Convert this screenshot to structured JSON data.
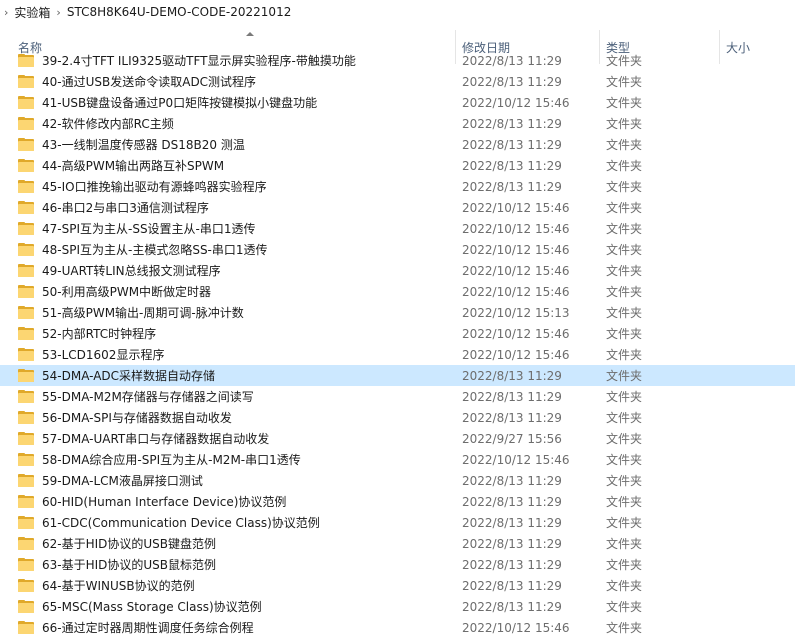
{
  "breadcrumb": {
    "items": [
      "实验箱",
      "STC8H8K64U-DEMO-CODE-20221012"
    ]
  },
  "columns": {
    "name": "名称",
    "date": "修改日期",
    "type": "类型",
    "size": "大小"
  },
  "rows": [
    {
      "name": "39-2.4寸TFT ILI9325驱动TFT显示屏实验程序-带触摸功能",
      "date": "2022/8/13 11:29",
      "type": "文件夹"
    },
    {
      "name": "40-通过USB发送命令读取ADC测试程序",
      "date": "2022/8/13 11:29",
      "type": "文件夹"
    },
    {
      "name": "41-USB键盘设备通过P0口矩阵按键模拟小键盘功能",
      "date": "2022/10/12 15:46",
      "type": "文件夹"
    },
    {
      "name": "42-软件修改内部RC主频",
      "date": "2022/8/13 11:29",
      "type": "文件夹"
    },
    {
      "name": "43-一线制温度传感器 DS18B20 测温",
      "date": "2022/8/13 11:29",
      "type": "文件夹"
    },
    {
      "name": "44-高级PWM输出两路互补SPWM",
      "date": "2022/8/13 11:29",
      "type": "文件夹"
    },
    {
      "name": "45-IO口推挽输出驱动有源蜂鸣器实验程序",
      "date": "2022/8/13 11:29",
      "type": "文件夹"
    },
    {
      "name": "46-串口2与串口3通信测试程序",
      "date": "2022/10/12 15:46",
      "type": "文件夹"
    },
    {
      "name": "47-SPI互为主从-SS设置主从-串口1透传",
      "date": "2022/10/12 15:46",
      "type": "文件夹"
    },
    {
      "name": "48-SPI互为主从-主模式忽略SS-串口1透传",
      "date": "2022/10/12 15:46",
      "type": "文件夹"
    },
    {
      "name": "49-UART转LIN总线报文测试程序",
      "date": "2022/10/12 15:46",
      "type": "文件夹"
    },
    {
      "name": "50-利用高级PWM中断做定时器",
      "date": "2022/10/12 15:46",
      "type": "文件夹"
    },
    {
      "name": "51-高级PWM输出-周期可调-脉冲计数",
      "date": "2022/10/12 15:13",
      "type": "文件夹"
    },
    {
      "name": "52-内部RTC时钟程序",
      "date": "2022/10/12 15:46",
      "type": "文件夹"
    },
    {
      "name": "53-LCD1602显示程序",
      "date": "2022/10/12 15:46",
      "type": "文件夹"
    },
    {
      "name": "54-DMA-ADC采样数据自动存储",
      "date": "2022/8/13 11:29",
      "type": "文件夹",
      "selected": true
    },
    {
      "name": "55-DMA-M2M存储器与存储器之间读写",
      "date": "2022/8/13 11:29",
      "type": "文件夹"
    },
    {
      "name": "56-DMA-SPI与存储器数据自动收发",
      "date": "2022/8/13 11:29",
      "type": "文件夹"
    },
    {
      "name": "57-DMA-UART串口与存储器数据自动收发",
      "date": "2022/9/27 15:56",
      "type": "文件夹"
    },
    {
      "name": "58-DMA综合应用-SPI互为主从-M2M-串口1透传",
      "date": "2022/10/12 15:46",
      "type": "文件夹"
    },
    {
      "name": "59-DMA-LCM液晶屏接口测试",
      "date": "2022/8/13 11:29",
      "type": "文件夹"
    },
    {
      "name": "60-HID(Human Interface Device)协议范例",
      "date": "2022/8/13 11:29",
      "type": "文件夹"
    },
    {
      "name": "61-CDC(Communication Device Class)协议范例",
      "date": "2022/8/13 11:29",
      "type": "文件夹"
    },
    {
      "name": "62-基于HID协议的USB键盘范例",
      "date": "2022/8/13 11:29",
      "type": "文件夹"
    },
    {
      "name": "63-基于HID协议的USB鼠标范例",
      "date": "2022/8/13 11:29",
      "type": "文件夹"
    },
    {
      "name": "64-基于WINUSB协议的范例",
      "date": "2022/8/13 11:29",
      "type": "文件夹"
    },
    {
      "name": "65-MSC(Mass Storage Class)协议范例",
      "date": "2022/8/13 11:29",
      "type": "文件夹"
    },
    {
      "name": "66-通过定时器周期性调度任务综合例程",
      "date": "2022/10/12 15:46",
      "type": "文件夹"
    }
  ],
  "icons": {
    "crumb_separator": "chevron-right-icon",
    "sort": "chevron-up-icon",
    "row": "folder-icon"
  },
  "colors": {
    "selected_row": "#cce8ff",
    "folder": "#fcd672",
    "header_text": "#4c607a"
  }
}
